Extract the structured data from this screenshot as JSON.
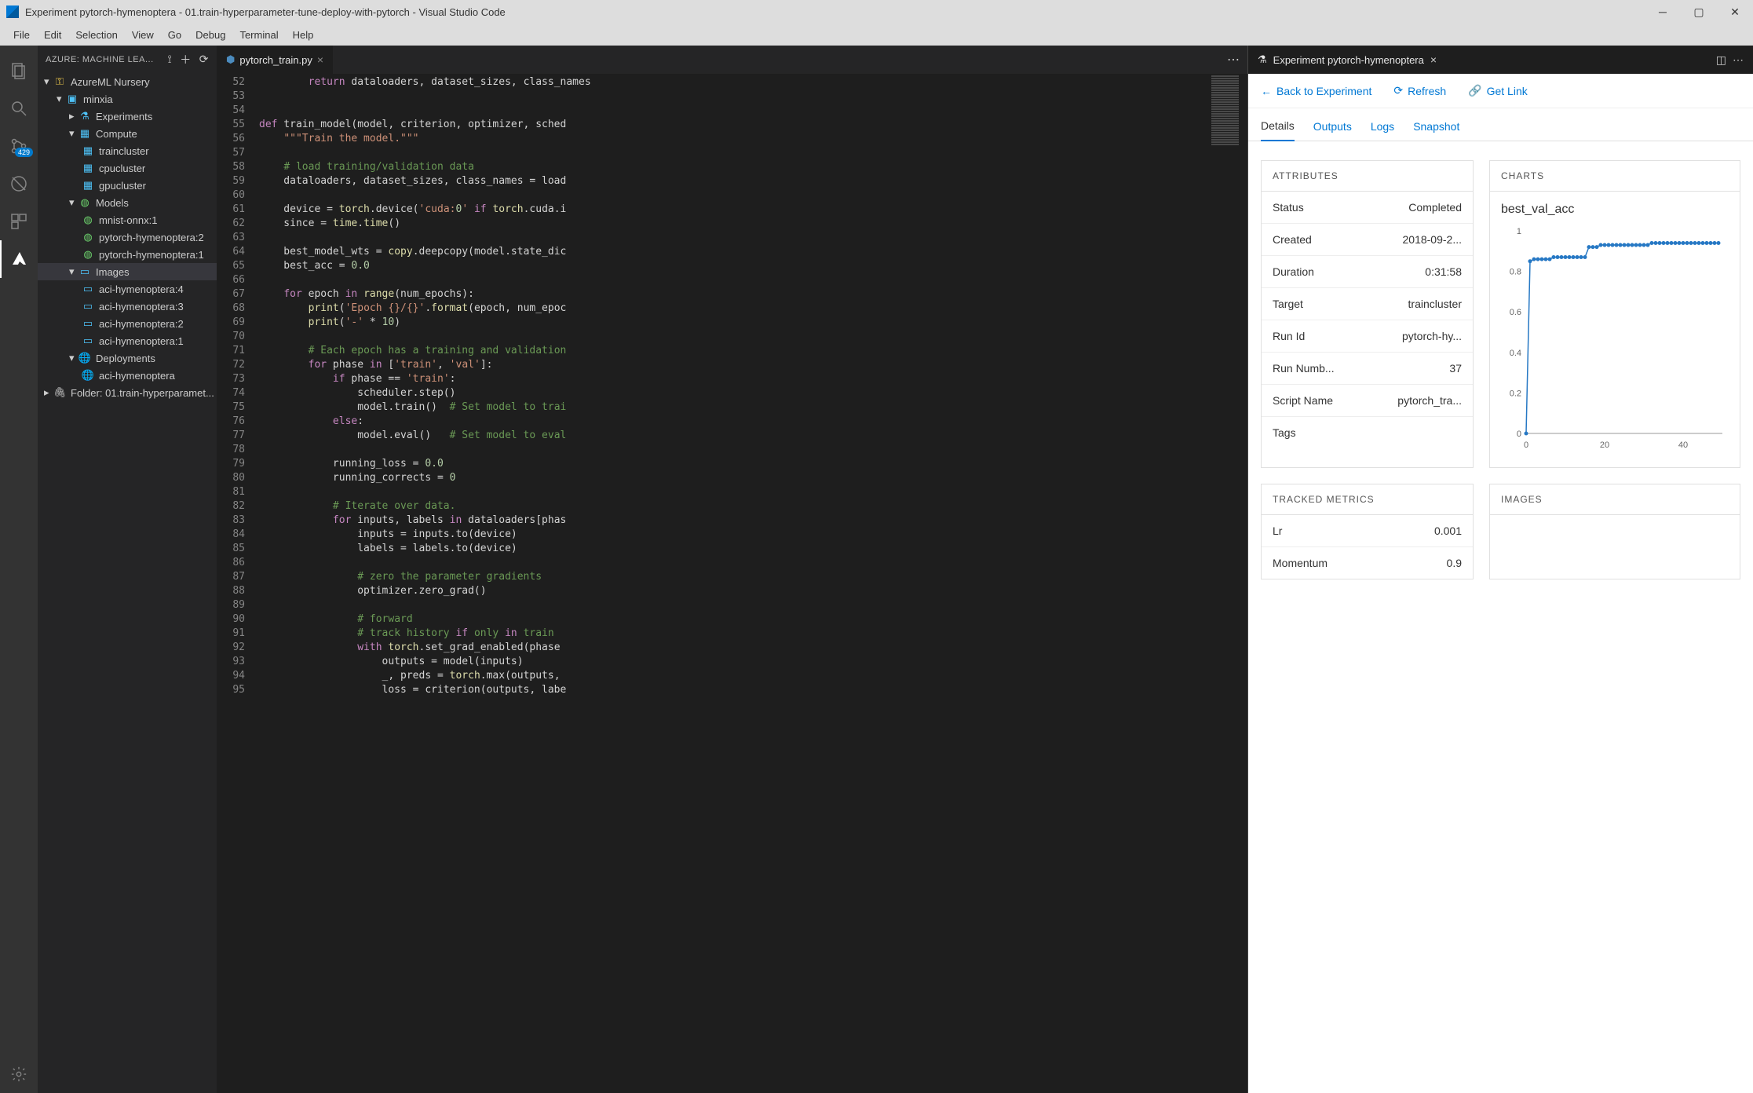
{
  "window": {
    "title": "Experiment pytorch-hymenoptera - 01.train-hyperparameter-tune-deploy-with-pytorch - Visual Studio Code"
  },
  "menu": [
    "File",
    "Edit",
    "Selection",
    "View",
    "Go",
    "Debug",
    "Terminal",
    "Help"
  ],
  "activity_badge": "429",
  "sidebar": {
    "title": "AZURE: MACHINE LEA...",
    "tree": {
      "root": "AzureML Nursery",
      "sub": "minxia",
      "experiments": "Experiments",
      "compute": "Compute",
      "compute_items": [
        "traincluster",
        "cpucluster",
        "gpucluster"
      ],
      "models": "Models",
      "model_items": [
        "mnist-onnx:1",
        "pytorch-hymenoptera:2",
        "pytorch-hymenoptera:1"
      ],
      "images": "Images",
      "image_items": [
        "aci-hymenoptera:4",
        "aci-hymenoptera:3",
        "aci-hymenoptera:2",
        "aci-hymenoptera:1"
      ],
      "deployments": "Deployments",
      "deployment_items": [
        "aci-hymenoptera"
      ],
      "folder": "Folder: 01.train-hyperparamet..."
    }
  },
  "editor": {
    "tab_name": "pytorch_train.py",
    "start_line": 52,
    "code_lines": [
      "        return dataloaders, dataset_sizes, class_names",
      "",
      "",
      "def train_model(model, criterion, optimizer, sched",
      "    \"\"\"Train the model.\"\"\"",
      "",
      "    # load training/validation data",
      "    dataloaders, dataset_sizes, class_names = load",
      "",
      "    device = torch.device('cuda:0' if torch.cuda.i",
      "    since = time.time()",
      "",
      "    best_model_wts = copy.deepcopy(model.state_dic",
      "    best_acc = 0.0",
      "",
      "    for epoch in range(num_epochs):",
      "        print('Epoch {}/{}'.format(epoch, num_epoc",
      "        print('-' * 10)",
      "",
      "        # Each epoch has a training and validation",
      "        for phase in ['train', 'val']:",
      "            if phase == 'train':",
      "                scheduler.step()",
      "                model.train()  # Set model to trai",
      "            else:",
      "                model.eval()   # Set model to eval",
      "",
      "            running_loss = 0.0",
      "            running_corrects = 0",
      "",
      "            # Iterate over data.",
      "            for inputs, labels in dataloaders[phas",
      "                inputs = inputs.to(device)",
      "                labels = labels.to(device)",
      "",
      "                # zero the parameter gradients",
      "                optimizer.zero_grad()",
      "",
      "                # forward",
      "                # track history if only in train",
      "                with torch.set_grad_enabled(phase ",
      "                    outputs = model(inputs)",
      "                    _, preds = torch.max(outputs, ",
      "                    loss = criterion(outputs, labe"
    ]
  },
  "right_panel": {
    "title": "Experiment pytorch-hymenoptera",
    "back": "Back to Experiment",
    "refresh": "Refresh",
    "getlink": "Get Link",
    "tabs": [
      "Details",
      "Outputs",
      "Logs",
      "Snapshot"
    ],
    "cards": {
      "attributes_title": "ATTRIBUTES",
      "charts_title": "CHARTS",
      "tracked_title": "TRACKED METRICS",
      "images_title": "IMAGES"
    },
    "attributes": [
      {
        "k": "Status",
        "v": "Completed"
      },
      {
        "k": "Created",
        "v": "2018-09-2..."
      },
      {
        "k": "Duration",
        "v": "0:31:58"
      },
      {
        "k": "Target",
        "v": "traincluster"
      },
      {
        "k": "Run Id",
        "v": "pytorch-hy..."
      },
      {
        "k": "Run Numb...",
        "v": "37"
      },
      {
        "k": "Script Name",
        "v": "pytorch_tra..."
      },
      {
        "k": "Tags",
        "v": ""
      }
    ],
    "chart_title": "best_val_acc",
    "tracked": [
      {
        "k": "Lr",
        "v": "0.001"
      },
      {
        "k": "Momentum",
        "v": "0.9"
      }
    ]
  },
  "chart_data": {
    "type": "line",
    "title": "best_val_acc",
    "xlabel": "",
    "ylabel": "",
    "ylim": [
      0,
      1
    ],
    "xlim": [
      0,
      50
    ],
    "x": [
      0,
      1,
      2,
      3,
      4,
      5,
      6,
      7,
      8,
      9,
      10,
      11,
      12,
      13,
      14,
      15,
      16,
      17,
      18,
      19,
      20,
      21,
      22,
      23,
      24,
      25,
      26,
      27,
      28,
      29,
      30,
      31,
      32,
      33,
      34,
      35,
      36,
      37,
      38,
      39,
      40,
      41,
      42,
      43,
      44,
      45,
      46,
      47,
      48,
      49
    ],
    "values": [
      0.0,
      0.85,
      0.86,
      0.86,
      0.86,
      0.86,
      0.86,
      0.87,
      0.87,
      0.87,
      0.87,
      0.87,
      0.87,
      0.87,
      0.87,
      0.87,
      0.92,
      0.92,
      0.92,
      0.93,
      0.93,
      0.93,
      0.93,
      0.93,
      0.93,
      0.93,
      0.93,
      0.93,
      0.93,
      0.93,
      0.93,
      0.93,
      0.94,
      0.94,
      0.94,
      0.94,
      0.94,
      0.94,
      0.94,
      0.94,
      0.94,
      0.94,
      0.94,
      0.94,
      0.94,
      0.94,
      0.94,
      0.94,
      0.94,
      0.94
    ],
    "y_ticks": [
      0,
      0.2,
      0.4,
      0.6,
      0.8,
      1
    ],
    "x_ticks": [
      0,
      20,
      40
    ]
  }
}
